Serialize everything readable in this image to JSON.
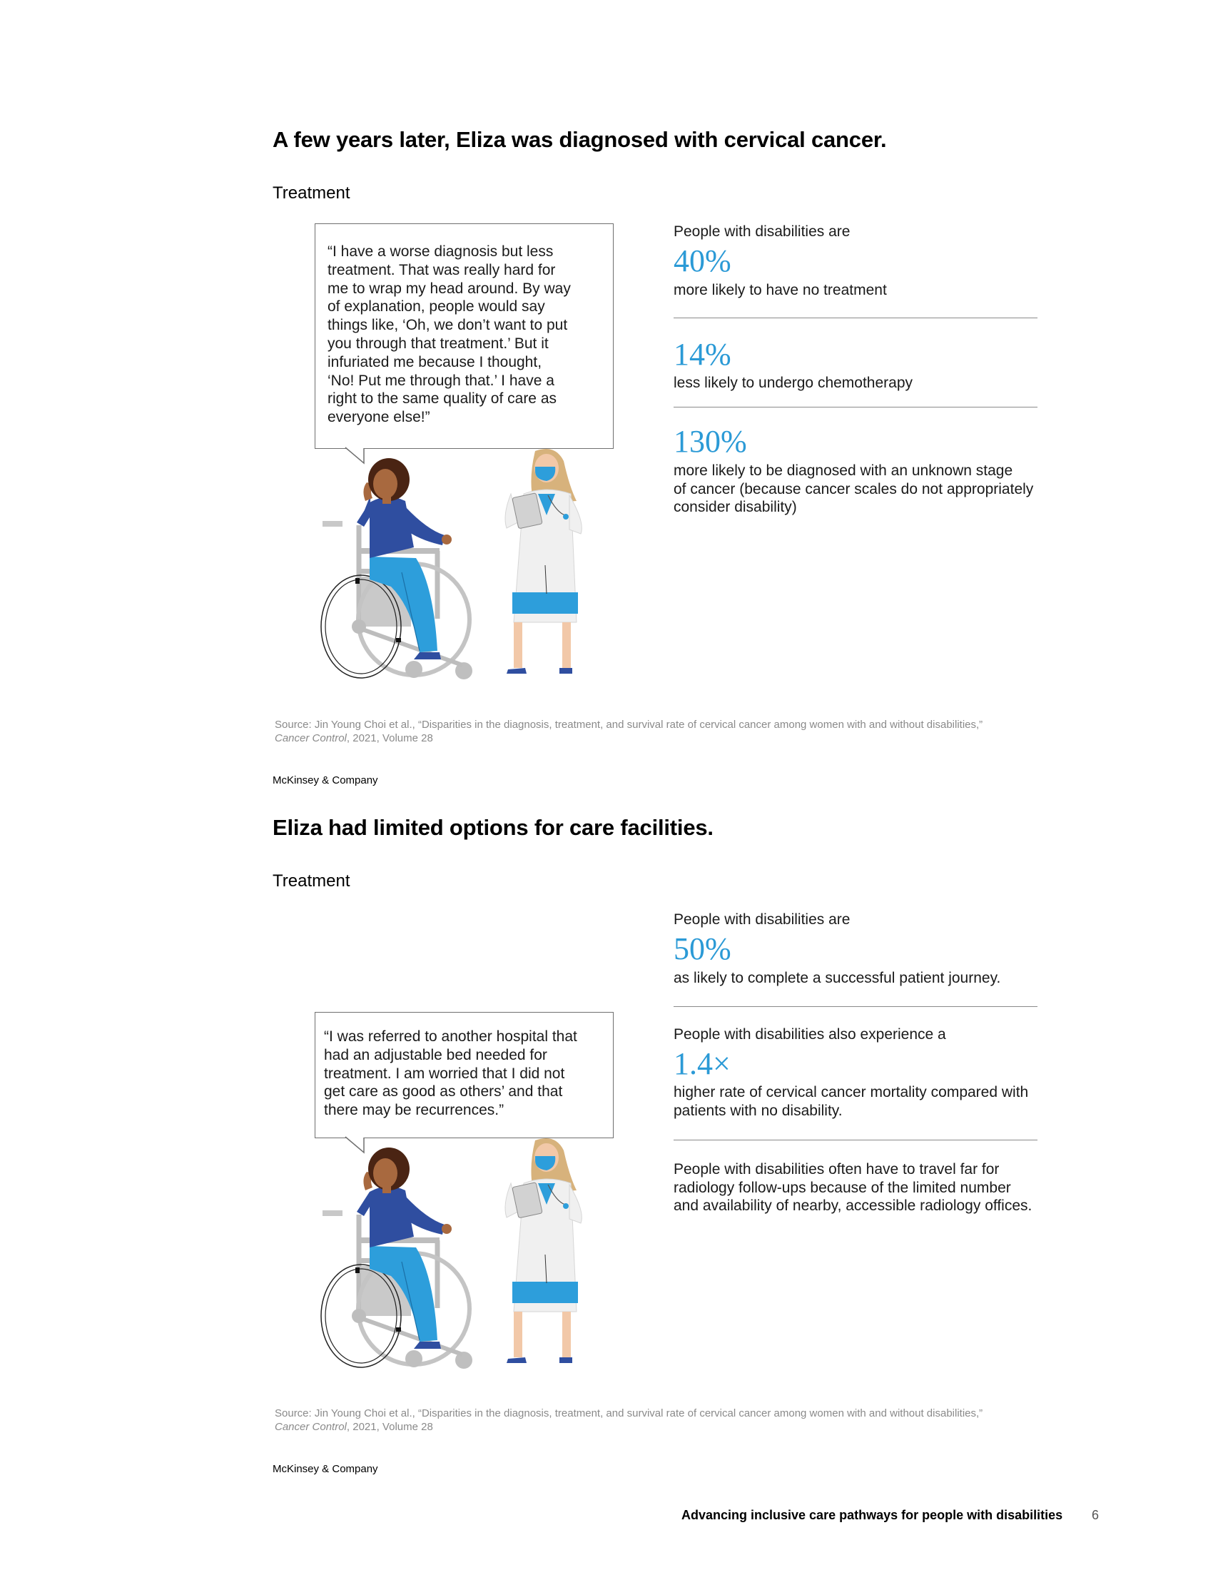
{
  "section1": {
    "title": "A few years later, Eliza was diagnosed with cervical cancer.",
    "subhead": "Treatment",
    "quote": "“I have a worse diagnosis but less\n treatment. That was really hard for\n me to wrap my head around. By way\n of explanation, people would say\n things like, ‘Oh, we don’t want to put\n you through that treatment.’ But it\n infuriated me because I thought,\n‘No! Put me through that.’ I have a\n right to the same quality of care as\n everyone else!”",
    "intro": "People with disabilities are",
    "stats": [
      {
        "value": "40%",
        "label": "more likely to have no treatment"
      },
      {
        "value": "14%",
        "label": "less likely to undergo chemotherapy"
      },
      {
        "value": "130%",
        "label": "more likely to be diagnosed with an unknown stage\nof cancer (because cancer scales do not appropriately\nconsider disability)"
      }
    ],
    "source_line1": "Source: Jin Young Choi et al., “Disparities in the diagnosis, treatment, and survival rate of cervical cancer among women with and without disabilities,”",
    "source_italic": "Cancer Control",
    "source_rest": ", 2021, Volume 28",
    "brand": "McKinsey & Company"
  },
  "section2": {
    "title": "Eliza had limited options for care facilities.",
    "subhead": "Treatment",
    "quote": "“I was referred to another hospital that\n had an adjustable bed needed for\n treatment. I am worried that I did not\n get care as good as others’ and that\n there may be recurrences.”",
    "stat1_intro": "People with disabilities are",
    "stat1_value": "50%",
    "stat1_label": "as likely to complete a successful patient journey.",
    "stat2_intro": "People with disabilities also experience a",
    "stat2_value": "1.4×",
    "stat2_label": "higher rate of cervical cancer mortality compared with\npatients with no disability.",
    "stat3_text": "People with disabilities often have to travel far for\nradiology follow-ups because of the limited number\nand availability of nearby, accessible radiology offices.",
    "source_line1": "Source: Jin Young Choi et al., “Disparities in the diagnosis, treatment, and survival rate of cervical cancer among women with and without disabilities,”",
    "source_italic": "Cancer Control",
    "source_rest": ", 2021, Volume 28",
    "brand": "McKinsey & Company"
  },
  "footer": {
    "title": "Advancing inclusive care pathways for people with disabilities",
    "page": "6"
  },
  "colors": {
    "accent": "#2b9ad6",
    "patient_top": "#2f4ea0",
    "patient_pants": "#2d9edb",
    "skin_dark": "#a8693f",
    "hair_dark": "#4a2413",
    "coat": "#f0f0f0",
    "hair_blonde": "#d7b27c"
  },
  "icons": [
    "patient-in-wheelchair-illustration",
    "doctor-illustration"
  ]
}
